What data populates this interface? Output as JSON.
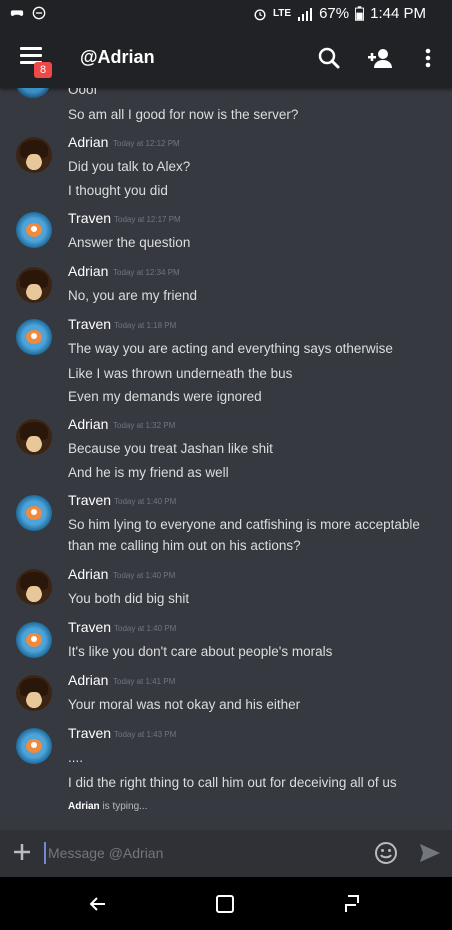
{
  "status_bar": {
    "network": "LTE",
    "battery": "67%",
    "time": "1:44 PM",
    "icons": [
      "gamepad-icon",
      "minus-circle-icon",
      "alarm-icon",
      "signal-icon",
      "battery-icon"
    ]
  },
  "header": {
    "title": "@Adrian",
    "menu_badge": "8",
    "icons": [
      "menu-icon",
      "search-icon",
      "add-friend-icon",
      "more-vertical-icon"
    ]
  },
  "messages": {
    "partial_top": "Ooof",
    "preceding_line": "So am all I good for now is the server?",
    "groups": [
      {
        "author": "Adrian",
        "time": "Today at 12:12 PM",
        "lines": [
          "Did you talk to Alex?",
          "I thought you did"
        ]
      },
      {
        "author": "Traven",
        "time": "Today at 12:17 PM",
        "lines": [
          "Answer the question"
        ]
      },
      {
        "author": "Adrian",
        "time": "Today at 12:34 PM",
        "lines": [
          "No, you are my friend"
        ]
      },
      {
        "author": "Traven",
        "time": "Today at 1:18 PM",
        "lines": [
          "The way you are acting and everything says otherwise",
          "Like I was thrown underneath the bus",
          "Even my demands were ignored"
        ]
      },
      {
        "author": "Adrian",
        "time": "Today at 1:32 PM",
        "lines": [
          "Because you treat Jashan like shit",
          "And he is my friend as well"
        ]
      },
      {
        "author": "Traven",
        "time": "Today at 1:40 PM",
        "lines": [
          "So him lying to everyone and catfishing is more acceptable than me calling him out on his actions?"
        ]
      },
      {
        "author": "Adrian",
        "time": "Today at 1:40 PM",
        "lines": [
          "You both did big shit"
        ]
      },
      {
        "author": "Traven",
        "time": "Today at 1:40 PM",
        "lines": [
          "It's like you don't care about people's morals"
        ]
      },
      {
        "author": "Adrian",
        "time": "Today at 1:41 PM",
        "lines": [
          "Your moral was not okay and his either"
        ]
      },
      {
        "author": "Traven",
        "time": "Today at 1:43 PM",
        "lines": [
          "....",
          "I did the right thing to call him out for deceiving all of us"
        ]
      }
    ]
  },
  "typing": {
    "user": "Adrian",
    "suffix": " is typing..."
  },
  "composer": {
    "placeholder": "Message @Adrian",
    "icons": [
      "plus-icon",
      "emoji-icon",
      "send-icon"
    ]
  },
  "nav_bar": {
    "icons": [
      "back-icon",
      "home-icon",
      "recents-icon"
    ]
  },
  "colors": {
    "background": "#36393f",
    "bars": "#202225",
    "composer": "#2f3136",
    "badge": "#f04747",
    "cursor": "#7289da"
  }
}
